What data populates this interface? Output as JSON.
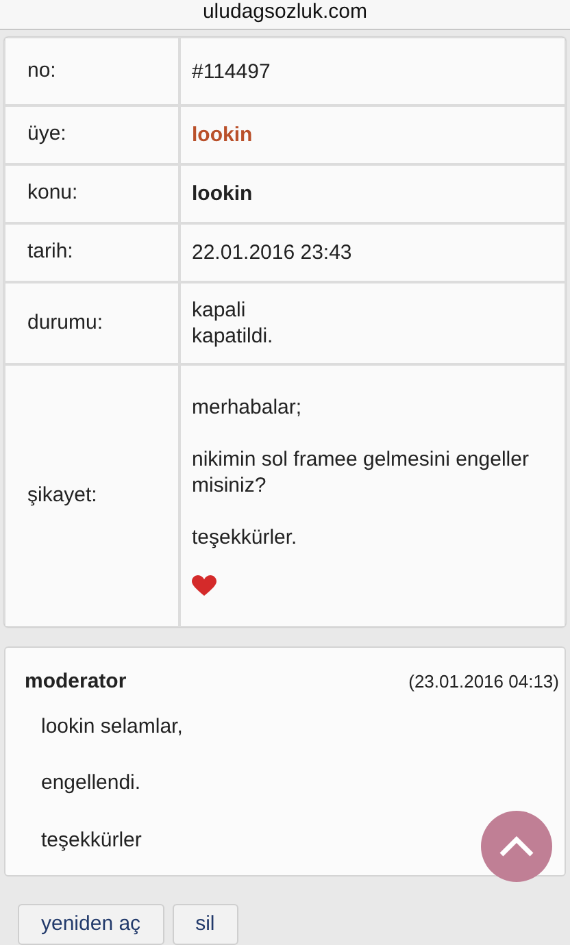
{
  "address_bar": {
    "url": "uludagsozluk.com"
  },
  "details": [
    {
      "label": "no:",
      "value": "#114497",
      "kind": "plain"
    },
    {
      "label": "üye:",
      "value": "lookin",
      "kind": "member"
    },
    {
      "label": "konu:",
      "value": "lookin",
      "kind": "bold"
    },
    {
      "label": "tarih:",
      "value": "22.01.2016 23:43",
      "kind": "plain"
    },
    {
      "label": "durumu:",
      "value": "kapali\nkapatildi.",
      "kind": "plain"
    },
    {
      "label": "şikayet:",
      "value": "merhabalar;\n\nnikimin sol framee gelmesini engeller misiniz?\n\nteşekkürler.",
      "kind": "plain",
      "heart": true
    }
  ],
  "reply": {
    "author": "moderator",
    "time": "(23.01.2016 04:13)",
    "paragraphs": [
      "lookin selamlar,",
      "engellendi.",
      "teşekkürler"
    ]
  },
  "buttons": [
    "yeniden aç",
    "sil"
  ]
}
